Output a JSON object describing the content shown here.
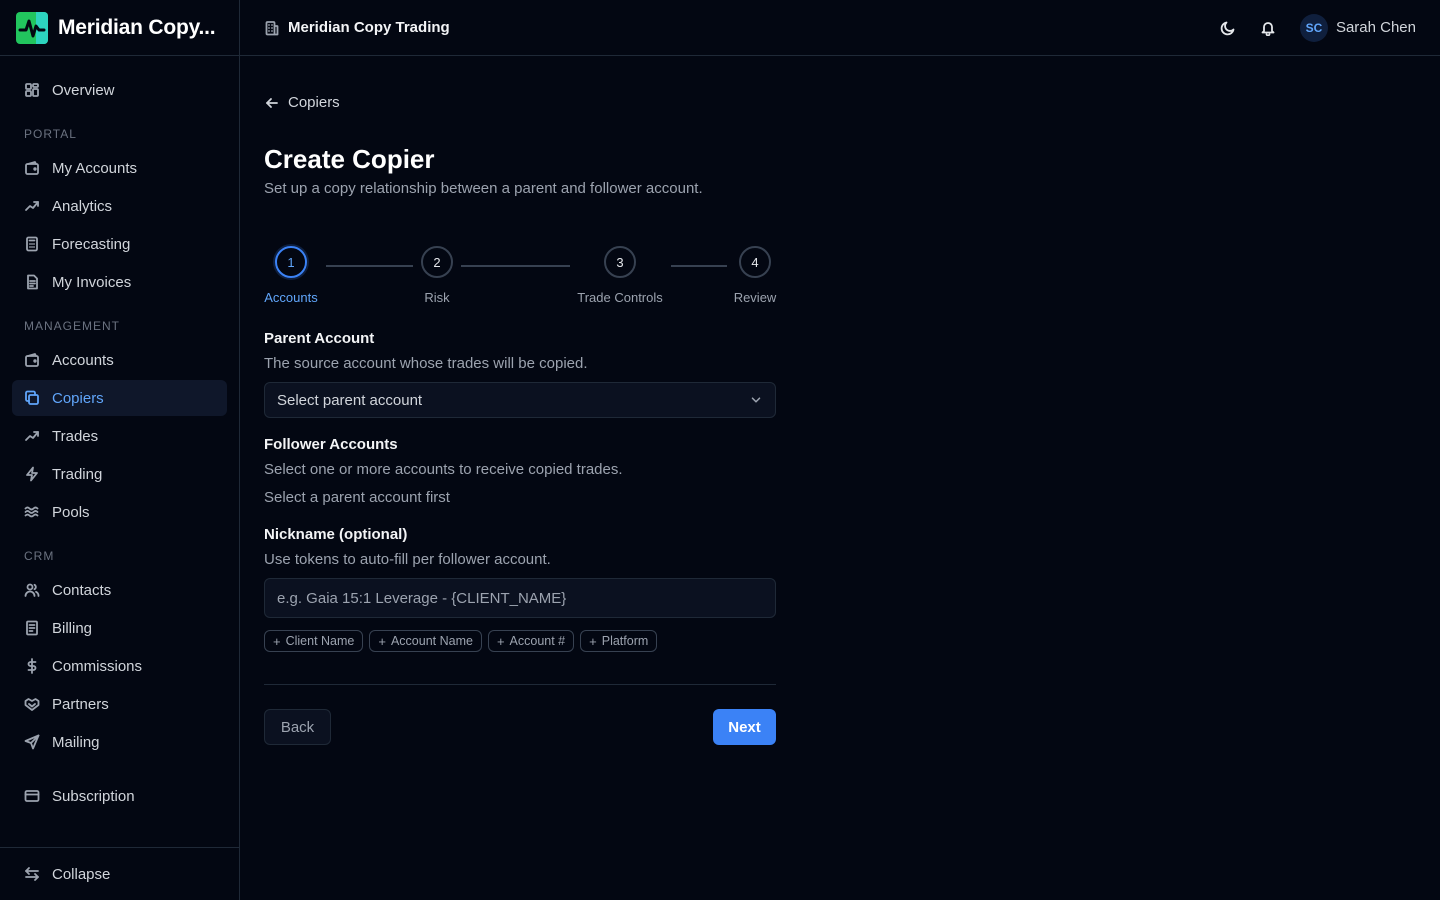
{
  "brand": {
    "name": "Meridian Copy...",
    "logo_icon": "meridian-logo-icon",
    "colors": {
      "logo_green": "#22c55e",
      "logo_teal": "#2dd4bf"
    }
  },
  "topbar": {
    "org_name": "Meridian Copy Trading",
    "org_icon": "building-icon",
    "theme_icon": "moon-icon",
    "notifications_icon": "bell-icon",
    "user": {
      "initials": "SC",
      "name": "Sarah Chen"
    }
  },
  "sidebar": {
    "overview": {
      "label": "Overview",
      "icon": "grid-icon"
    },
    "sections": [
      {
        "title": "PORTAL",
        "items": [
          {
            "label": "My Accounts",
            "icon": "wallet-icon"
          },
          {
            "label": "Analytics",
            "icon": "trend-up-icon"
          },
          {
            "label": "Forecasting",
            "icon": "calculator-icon"
          },
          {
            "label": "My Invoices",
            "icon": "document-icon"
          }
        ]
      },
      {
        "title": "MANAGEMENT",
        "items": [
          {
            "label": "Accounts",
            "icon": "wallet-icon"
          },
          {
            "label": "Copiers",
            "icon": "copy-icon",
            "active": true
          },
          {
            "label": "Trades",
            "icon": "trend-up-icon"
          },
          {
            "label": "Trading",
            "icon": "lightning-icon"
          },
          {
            "label": "Pools",
            "icon": "waves-icon"
          }
        ]
      },
      {
        "title": "CRM",
        "items": [
          {
            "label": "Contacts",
            "icon": "users-icon"
          },
          {
            "label": "Billing",
            "icon": "receipt-icon"
          },
          {
            "label": "Commissions",
            "icon": "dollar-icon"
          },
          {
            "label": "Partners",
            "icon": "handshake-icon"
          },
          {
            "label": "Mailing",
            "icon": "send-icon"
          }
        ]
      }
    ],
    "subscription": {
      "label": "Subscription",
      "icon": "credit-card-icon"
    },
    "collapse": {
      "label": "Collapse",
      "icon": "swap-arrows-icon"
    }
  },
  "page": {
    "back_label": "Copiers",
    "title": "Create Copier",
    "subtitle": "Set up a copy relationship between a parent and follower account.",
    "steps": [
      {
        "number": "1",
        "label": "Accounts",
        "active": true
      },
      {
        "number": "2",
        "label": "Risk"
      },
      {
        "number": "3",
        "label": "Trade Controls"
      },
      {
        "number": "4",
        "label": "Review"
      }
    ],
    "parent": {
      "label": "Parent Account",
      "help": "The source account whose trades will be copied.",
      "placeholder": "Select parent account"
    },
    "followers": {
      "label": "Follower Accounts",
      "help": "Select one or more accounts to receive copied trades.",
      "empty": "Select a parent account first"
    },
    "nickname": {
      "label": "Nickname (optional)",
      "help": "Use tokens to auto-fill per follower account.",
      "value": "",
      "placeholder": "e.g. Gaia 15:1 Leverage - {CLIENT_NAME}",
      "tokens": [
        "Client Name",
        "Account Name",
        "Account #",
        "Platform"
      ]
    },
    "actions": {
      "back": "Back",
      "next": "Next"
    },
    "colors": {
      "accent": "#3b82f6",
      "accent_text": "#60a5fa"
    }
  }
}
